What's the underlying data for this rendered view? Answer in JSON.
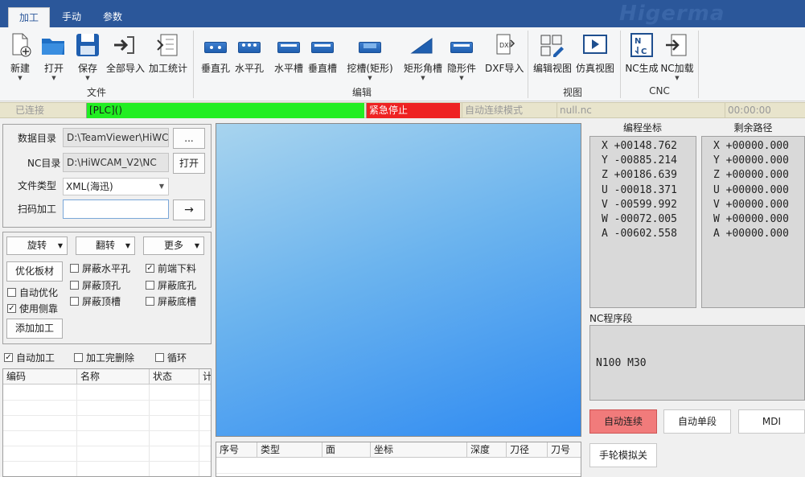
{
  "tabs": [
    "加工",
    "手动",
    "参数"
  ],
  "watermark": "Higerma",
  "ribbon": {
    "buttons": {
      "new": "新建",
      "open": "打开",
      "save": "保存",
      "import_all": "全部导入",
      "stats": "加工统计",
      "vertical_hole": "垂直孔",
      "horizontal_hole": "水平孔",
      "horizontal_slot": "水平槽",
      "vertical_slot": "垂直槽",
      "pocket_rect": "挖槽(矩形)",
      "rect_corner_slot": "矩形角槽",
      "hidden_part": "隐形件",
      "dxf_import": "DXF导入",
      "edit_view": "编辑视图",
      "sim_view": "仿真视图",
      "nc_gen": "NC生成",
      "nc_load": "NC加载"
    },
    "groups": {
      "file": "文件",
      "edit": "编辑",
      "view": "视图",
      "cnc": "CNC"
    }
  },
  "status": {
    "connection": "已连接",
    "plc": "[PLC]()",
    "estop": "紧急停止",
    "mode": "自动连续模式",
    "file": "null.nc",
    "time": "00:00:00",
    "colors": {
      "plc": "#22ee22",
      "estop": "#ee2222",
      "bar": "#e8e4cc"
    }
  },
  "form": {
    "data_dir_label": "数据目录",
    "data_dir_value": "D:\\TeamViewer\\HiWCAM",
    "browse_label": "...",
    "nc_dir_label": "NC目录",
    "nc_dir_value": "D:\\HiWCAM_V2\\NC",
    "open_label": "打开",
    "file_type_label": "文件类型",
    "file_type_value": "XML(海迅)",
    "scan_label": "扫码加工",
    "scan_value": "",
    "go_label": "→"
  },
  "ops": {
    "rotate": "旋转",
    "flip": "翻转",
    "more": "更多",
    "optimize": "优化板材",
    "auto_optimize": "自动优化",
    "use_side": "使用侧靠",
    "add_process": "添加加工",
    "mask_h_hole": "屏蔽水平孔",
    "mask_top_hole": "屏蔽顶孔",
    "mask_top_slot": "屏蔽顶槽",
    "front_unload": "前端下料",
    "mask_bottom_hole": "屏蔽底孔",
    "mask_bottom_slot": "屏蔽底槽"
  },
  "checks": {
    "auto_process": "自动加工",
    "delete_done": "加工完删除",
    "loop": "循环"
  },
  "job_table": {
    "headers": [
      "编码",
      "名称",
      "状态",
      "计"
    ]
  },
  "op_table": {
    "headers": [
      "序号",
      "类型",
      "面",
      "坐标",
      "深度",
      "刀径",
      "刀号"
    ]
  },
  "coords": {
    "program_label": "编程坐标",
    "remaining_label": "剩余路径",
    "program": [
      "X +00148.762",
      "Y -00885.214",
      "Z +00186.639",
      "U -00018.371",
      "V -00599.992",
      "W -00072.005",
      "A -00602.558"
    ],
    "remaining": [
      "X +00000.000",
      "Y +00000.000",
      "Z +00000.000",
      "U +00000.000",
      "V +00000.000",
      "W +00000.000",
      "A +00000.000"
    ]
  },
  "nc": {
    "label": "NC程序段",
    "line": "N100 M30"
  },
  "run_buttons": {
    "auto_continuous": "自动连续",
    "auto_single": "自动单段",
    "mdi": "MDI",
    "handwheel": "手轮模拟关"
  }
}
